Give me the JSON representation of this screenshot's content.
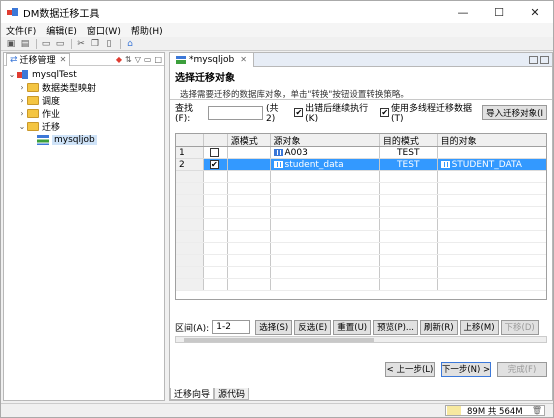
{
  "window": {
    "title": "DM数据迁移工具",
    "minimize": "—",
    "maximize": "☐",
    "close": "✕"
  },
  "menu": [
    "文件(F)",
    "编辑(E)",
    "窗口(W)",
    "帮助(H)"
  ],
  "left_panel": {
    "tab_label": "迁移管理",
    "tree": [
      {
        "label": "mysqlTest",
        "level": 0,
        "expanded": true,
        "icon": "db"
      },
      {
        "label": "数据类型映射",
        "level": 1,
        "expanded": false,
        "icon": "folder"
      },
      {
        "label": "调度",
        "level": 1,
        "expanded": false,
        "icon": "folder"
      },
      {
        "label": "作业",
        "level": 1,
        "expanded": false,
        "icon": "folder"
      },
      {
        "label": "迁移",
        "level": 1,
        "expanded": true,
        "icon": "folder"
      },
      {
        "label": "mysqljob",
        "level": 2,
        "expanded": false,
        "icon": "job",
        "selected": true
      }
    ]
  },
  "editor": {
    "tab_label": "*mysqljob",
    "title": "选择迁移对象",
    "description": "选择需要迁移的数据库对象，单击\"转换\"按钮设置转换策略。",
    "filter": {
      "find_label": "查找(F):",
      "find_value": "",
      "count_text": "(共 2)",
      "continue_on_error_label": "出错后继续执行(K)",
      "continue_on_error_checked": true,
      "multithread_label": "使用多线程迁移数据(T)",
      "multithread_checked": true,
      "import_button": "导入迁移对象(I"
    },
    "grid": {
      "columns": [
        "",
        "源模式",
        "源对象",
        "目的模式",
        "目的对象"
      ],
      "rows": [
        {
          "num": "1",
          "checked": false,
          "source_schema": "",
          "source_object": "A003",
          "target_schema": "TEST",
          "target_object": "",
          "selected": false
        },
        {
          "num": "2",
          "checked": true,
          "source_schema": "",
          "source_object": "student_data",
          "target_schema": "TEST",
          "target_object": "STUDENT_DATA",
          "selected": true
        }
      ],
      "check_mark": "✔"
    },
    "range": {
      "label": "区间(A):",
      "value": "1-2",
      "buttons": [
        "选择(S)",
        "反选(E)",
        "重置(U)",
        "预览(P)...",
        "刷新(R)",
        "上移(M)",
        "下移(D)"
      ]
    },
    "nav": {
      "prev": "< 上一步(L)",
      "next": "下一步(N) >",
      "finish": "完成(F)"
    },
    "bottom_tabs": [
      "迁移向导",
      "源代码"
    ]
  },
  "status": {
    "memory": "89M 共 564M"
  }
}
